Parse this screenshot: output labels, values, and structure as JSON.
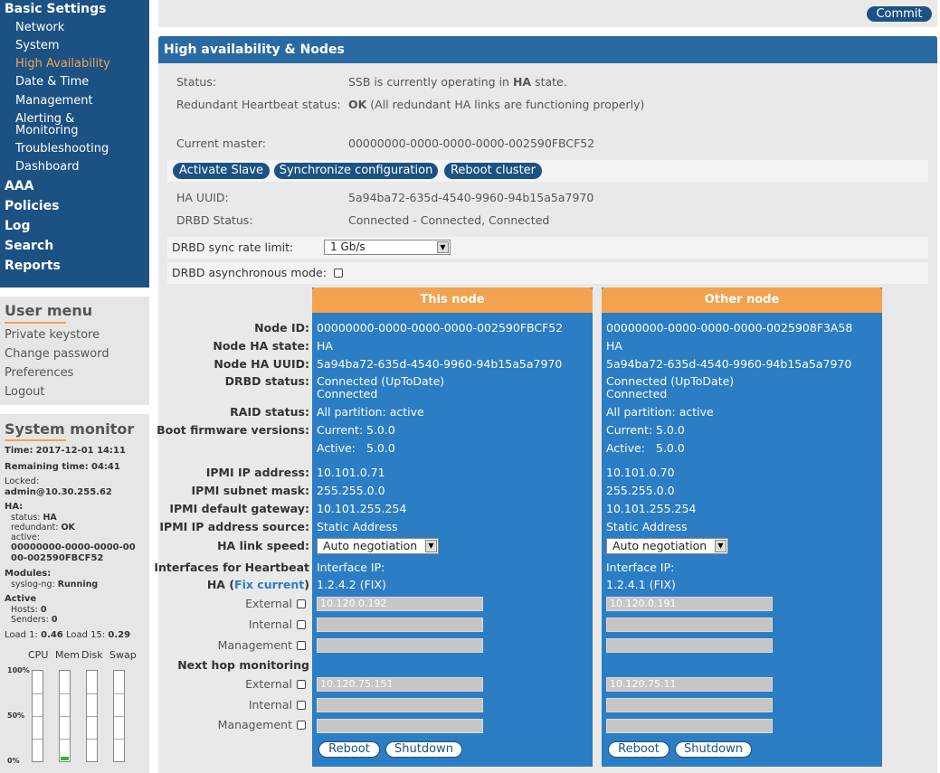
{
  "nav": {
    "basic_settings": "Basic Settings",
    "items": [
      "Network",
      "System",
      "High Availability",
      "Date & Time",
      "Management",
      "Alerting &",
      "Monitoring",
      "Troubleshooting",
      "Dashboard"
    ],
    "aaa": "AAA",
    "policies": "Policies",
    "log": "Log",
    "search": "Search",
    "reports": "Reports"
  },
  "user_menu": {
    "title": "User menu",
    "links": [
      "Private keystore",
      "Change password",
      "Preferences",
      "Logout"
    ]
  },
  "system_monitor": {
    "title": "System monitor",
    "time_label": "Time:",
    "time": "2017-12-01 14:11",
    "remaining_label": "Remaining time:",
    "remaining": "04:41",
    "locked_label": "Locked:",
    "locked": "admin@10.30.255.62",
    "ha_label": "HA:",
    "ha_status_label": "status:",
    "ha_status": "HA",
    "ha_redundant_label": "redundant:",
    "ha_redundant": "OK",
    "ha_active_label": "active:",
    "ha_active_1": "00000000-0000-0000-00",
    "ha_active_2": "00-002590FBCF52",
    "modules_label": "Modules:",
    "module_name": "syslog-ng:",
    "module_state": "Running",
    "active_label": "Active",
    "hosts_label": "Hosts:",
    "hosts": "0",
    "senders_label": "Senders:",
    "senders": "0",
    "load1_label": "Load 1:",
    "load1": "0.46",
    "load15_label": "Load 15:",
    "load15": "0.29",
    "bar_labels": [
      "CPU",
      "Mem",
      "Disk",
      "Swap"
    ],
    "scale": [
      "100%",
      "50%",
      "0%"
    ],
    "bar_levels": [
      0.0,
      0.04,
      0.0,
      0.0
    ]
  },
  "toolbar": {
    "commit": "Commit"
  },
  "ha": {
    "title": "High availability & Nodes",
    "status_label": "Status:",
    "status_pre": "SSB is currently operating in ",
    "status_bold": "HA",
    "status_post": " state.",
    "redundant_label": "Redundant Heartbeat status:",
    "redundant_bold": "OK",
    "redundant_rest": " (All redundant HA links are functioning properly)",
    "master_label": "Current master:",
    "master": "00000000-0000-0000-0000-002590FBCF52",
    "buttons": {
      "activate_slave": "Activate Slave",
      "sync": "Synchronize configuration",
      "reboot_cluster": "Reboot cluster"
    },
    "uuid_label": "HA UUID:",
    "uuid": "5a94ba72-635d-4540-9960-94b15a5a7970",
    "drbd_status_label": "DRBD Status:",
    "drbd_status": "Connected - Connected, Connected",
    "sync_rate_label": "DRBD sync rate limit:",
    "sync_rate": "1 Gb/s",
    "async_label": "DRBD asynchronous mode:"
  },
  "row_labels": {
    "node_id": "Node ID:",
    "node_ha_state": "Node HA state:",
    "node_ha_uuid": "Node HA UUID:",
    "drbd_status": "DRBD status:",
    "raid_status": "RAID status:",
    "boot_fw": "Boot firmware versions:",
    "ipmi_ip": "IPMI IP address:",
    "ipmi_mask": "IPMI subnet mask:",
    "ipmi_gw": "IPMI default gateway:",
    "ipmi_src": "IPMI IP address source:",
    "ha_link_speed": "HA link speed:",
    "interfaces_hb": "Interfaces for Heartbeat",
    "ha_pre": "HA (",
    "fix_current": "Fix current",
    "ha_post": ")",
    "external": "External",
    "internal": "Internal",
    "management": "Management",
    "next_hop": "Next hop monitoring"
  },
  "this_node": {
    "title": "This node",
    "node_id": "00000000-0000-0000-0000-002590FBCF52",
    "ha_state": "HA",
    "ha_uuid": "5a94ba72-635d-4540-9960-94b15a5a7970",
    "drbd_1": "Connected (UpToDate)",
    "drbd_2": "Connected",
    "raid": "All partition: active",
    "fw_current_label": "Current:",
    "fw_current": "5.0.0",
    "fw_active_label": "Active:",
    "fw_active": "5.0.0",
    "ipmi_ip": "10.101.0.71",
    "ipmi_mask": "255.255.0.0",
    "ipmi_gw": "10.101.255.254",
    "ipmi_src": "Static Address",
    "link_speed": "Auto negotiation",
    "iface_ip_label": "Interface IP:",
    "ha_ip": "1.2.4.2 (FIX)",
    "hb_external": "10.120.0.192",
    "hb_internal": "",
    "hb_management": "",
    "nh_external": "10.120.75.151",
    "nh_internal": "",
    "nh_management": "",
    "reboot": "Reboot",
    "shutdown": "Shutdown"
  },
  "other_node": {
    "title": "Other node",
    "node_id": "00000000-0000-0000-0000-0025908F3A58",
    "ha_state": "HA",
    "ha_uuid": "5a94ba72-635d-4540-9960-94b15a5a7970",
    "drbd_1": "Connected (UpToDate)",
    "drbd_2": "Connected",
    "raid": "All partition: active",
    "fw_current_label": "Current:",
    "fw_current": "5.0.0",
    "fw_active_label": "Active:",
    "fw_active": "5.0.0",
    "ipmi_ip": "10.101.0.70",
    "ipmi_mask": "255.255.0.0",
    "ipmi_gw": "10.101.255.254",
    "ipmi_src": "Static Address",
    "link_speed": "Auto negotiation",
    "iface_ip_label": "Interface IP:",
    "ha_ip": "1.2.4.1 (FIX)",
    "hb_external": "10.120.0.191",
    "hb_internal": "",
    "hb_management": "",
    "nh_external": "10.120.75.11",
    "nh_internal": "",
    "nh_management": "",
    "reboot": "Reboot",
    "shutdown": "Shutdown"
  },
  "colors": {
    "nav_bg": "#1c5283",
    "accent_orange": "#f3a24f",
    "node_blue": "#2b7dc4",
    "header_blue": "#2a6aa3",
    "panel_grey": "#e9e9e9",
    "ok_green": "#2db92d"
  },
  "icons": {
    "dropdown": "triangle-down-icon"
  }
}
